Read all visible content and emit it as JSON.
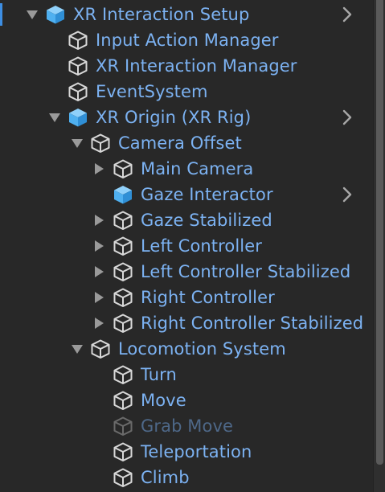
{
  "hierarchy": {
    "items": [
      {
        "label": "XR Interaction Setup",
        "depth": 0,
        "expand": "down",
        "icon": "prefab-cube-icon",
        "chevron": true,
        "disabled": false
      },
      {
        "label": "Input Action Manager",
        "depth": 1,
        "expand": "none",
        "icon": "gameobject-cube-icon",
        "chevron": false,
        "disabled": false
      },
      {
        "label": "XR Interaction Manager",
        "depth": 1,
        "expand": "none",
        "icon": "gameobject-cube-icon",
        "chevron": false,
        "disabled": false
      },
      {
        "label": "EventSystem",
        "depth": 1,
        "expand": "none",
        "icon": "gameobject-cube-icon",
        "chevron": false,
        "disabled": false
      },
      {
        "label": "XR Origin (XR Rig)",
        "depth": 1,
        "expand": "down",
        "icon": "prefab-cube-icon",
        "chevron": true,
        "disabled": false
      },
      {
        "label": "Camera Offset",
        "depth": 2,
        "expand": "down",
        "icon": "gameobject-cube-icon",
        "chevron": false,
        "disabled": false
      },
      {
        "label": "Main Camera",
        "depth": 3,
        "expand": "right",
        "icon": "gameobject-cube-icon",
        "chevron": false,
        "disabled": false
      },
      {
        "label": "Gaze Interactor",
        "depth": 3,
        "expand": "none",
        "icon": "prefab-cube-icon",
        "chevron": true,
        "disabled": false
      },
      {
        "label": "Gaze Stabilized",
        "depth": 3,
        "expand": "right",
        "icon": "gameobject-cube-icon",
        "chevron": false,
        "disabled": false
      },
      {
        "label": "Left Controller",
        "depth": 3,
        "expand": "right",
        "icon": "gameobject-cube-icon",
        "chevron": false,
        "disabled": false
      },
      {
        "label": "Left Controller Stabilized",
        "depth": 3,
        "expand": "right",
        "icon": "gameobject-cube-icon",
        "chevron": false,
        "disabled": false
      },
      {
        "label": "Right Controller",
        "depth": 3,
        "expand": "right",
        "icon": "gameobject-cube-icon",
        "chevron": false,
        "disabled": false
      },
      {
        "label": "Right Controller Stabilized",
        "depth": 3,
        "expand": "right",
        "icon": "gameobject-cube-icon",
        "chevron": false,
        "disabled": false
      },
      {
        "label": "Locomotion System",
        "depth": 2,
        "expand": "down",
        "icon": "gameobject-cube-icon",
        "chevron": false,
        "disabled": false
      },
      {
        "label": "Turn",
        "depth": 3,
        "expand": "none",
        "icon": "gameobject-cube-icon",
        "chevron": false,
        "disabled": false
      },
      {
        "label": "Move",
        "depth": 3,
        "expand": "none",
        "icon": "gameobject-cube-icon",
        "chevron": false,
        "disabled": false
      },
      {
        "label": "Grab Move",
        "depth": 3,
        "expand": "none",
        "icon": "gameobject-cube-icon",
        "chevron": false,
        "disabled": true
      },
      {
        "label": "Teleportation",
        "depth": 3,
        "expand": "none",
        "icon": "gameobject-cube-icon",
        "chevron": false,
        "disabled": false
      },
      {
        "label": "Climb",
        "depth": 3,
        "expand": "none",
        "icon": "gameobject-cube-icon",
        "chevron": false,
        "disabled": false
      }
    ]
  },
  "colors": {
    "background": "#282828",
    "label": "#7cb2f2",
    "label_disabled": "#4e6888",
    "prefab_icon": "#4fb0f0",
    "outline_icon": "#d8d8d8",
    "outline_icon_disabled": "#6a6a6a",
    "arrow": "#9a9a9a",
    "selection_accent": "#3d8ee3"
  }
}
